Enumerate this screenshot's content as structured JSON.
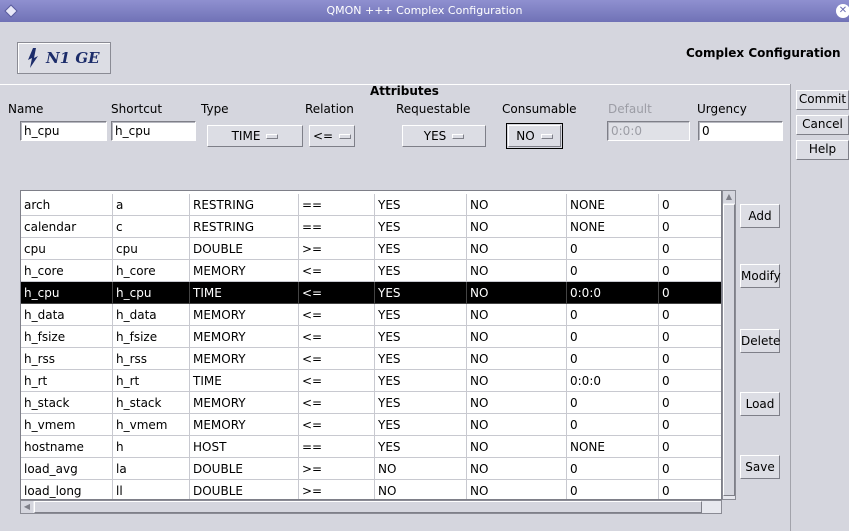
{
  "window": {
    "title": "QMON +++ Complex Configuration"
  },
  "header": {
    "logo_text": "N1 GE",
    "page_title": "Complex Configuration"
  },
  "attributes": {
    "heading": "Attributes",
    "labels": {
      "name": "Name",
      "shortcut": "Shortcut",
      "type": "Type",
      "relation": "Relation",
      "requestable": "Requestable",
      "consumable": "Consumable",
      "default": "Default",
      "urgency": "Urgency"
    },
    "values": {
      "name": "h_cpu",
      "shortcut": "h_cpu",
      "type": "TIME",
      "relation": "<=",
      "requestable": "YES",
      "consumable": "NO",
      "default": "0:0:0",
      "urgency": "0"
    }
  },
  "table": {
    "selected_index": 4,
    "rows": [
      [
        "arch",
        "a",
        "RESTRING",
        "==",
        "YES",
        "NO",
        "NONE",
        "0"
      ],
      [
        "calendar",
        "c",
        "RESTRING",
        "==",
        "YES",
        "NO",
        "NONE",
        "0"
      ],
      [
        "cpu",
        "cpu",
        "DOUBLE",
        ">=",
        "YES",
        "NO",
        "0",
        "0"
      ],
      [
        "h_core",
        "h_core",
        "MEMORY",
        "<=",
        "YES",
        "NO",
        "0",
        "0"
      ],
      [
        "h_cpu",
        "h_cpu",
        "TIME",
        "<=",
        "YES",
        "NO",
        "0:0:0",
        "0"
      ],
      [
        "h_data",
        "h_data",
        "MEMORY",
        "<=",
        "YES",
        "NO",
        "0",
        "0"
      ],
      [
        "h_fsize",
        "h_fsize",
        "MEMORY",
        "<=",
        "YES",
        "NO",
        "0",
        "0"
      ],
      [
        "h_rss",
        "h_rss",
        "MEMORY",
        "<=",
        "YES",
        "NO",
        "0",
        "0"
      ],
      [
        "h_rt",
        "h_rt",
        "TIME",
        "<=",
        "YES",
        "NO",
        "0:0:0",
        "0"
      ],
      [
        "h_stack",
        "h_stack",
        "MEMORY",
        "<=",
        "YES",
        "NO",
        "0",
        "0"
      ],
      [
        "h_vmem",
        "h_vmem",
        "MEMORY",
        "<=",
        "YES",
        "NO",
        "0",
        "0"
      ],
      [
        "hostname",
        "h",
        "HOST",
        "==",
        "YES",
        "NO",
        "NONE",
        "0"
      ],
      [
        "load_avg",
        "la",
        "DOUBLE",
        ">=",
        "NO",
        "NO",
        "0",
        "0"
      ],
      [
        "load_long",
        "ll",
        "DOUBLE",
        ">=",
        "NO",
        "NO",
        "0",
        "0"
      ]
    ]
  },
  "actions": {
    "add": "Add",
    "modify": "Modify",
    "delete": "Delete",
    "load": "Load",
    "save": "Save"
  },
  "side": {
    "commit": "Commit",
    "cancel": "Cancel",
    "help": "Help"
  },
  "icons": {
    "window": "diamond-icon",
    "close": "close-icon",
    "logo": "n1ge-logo-icon"
  },
  "colors": {
    "titlebar": "#7c7ec2",
    "selection": "#000000",
    "panel": "#d5d6de"
  }
}
